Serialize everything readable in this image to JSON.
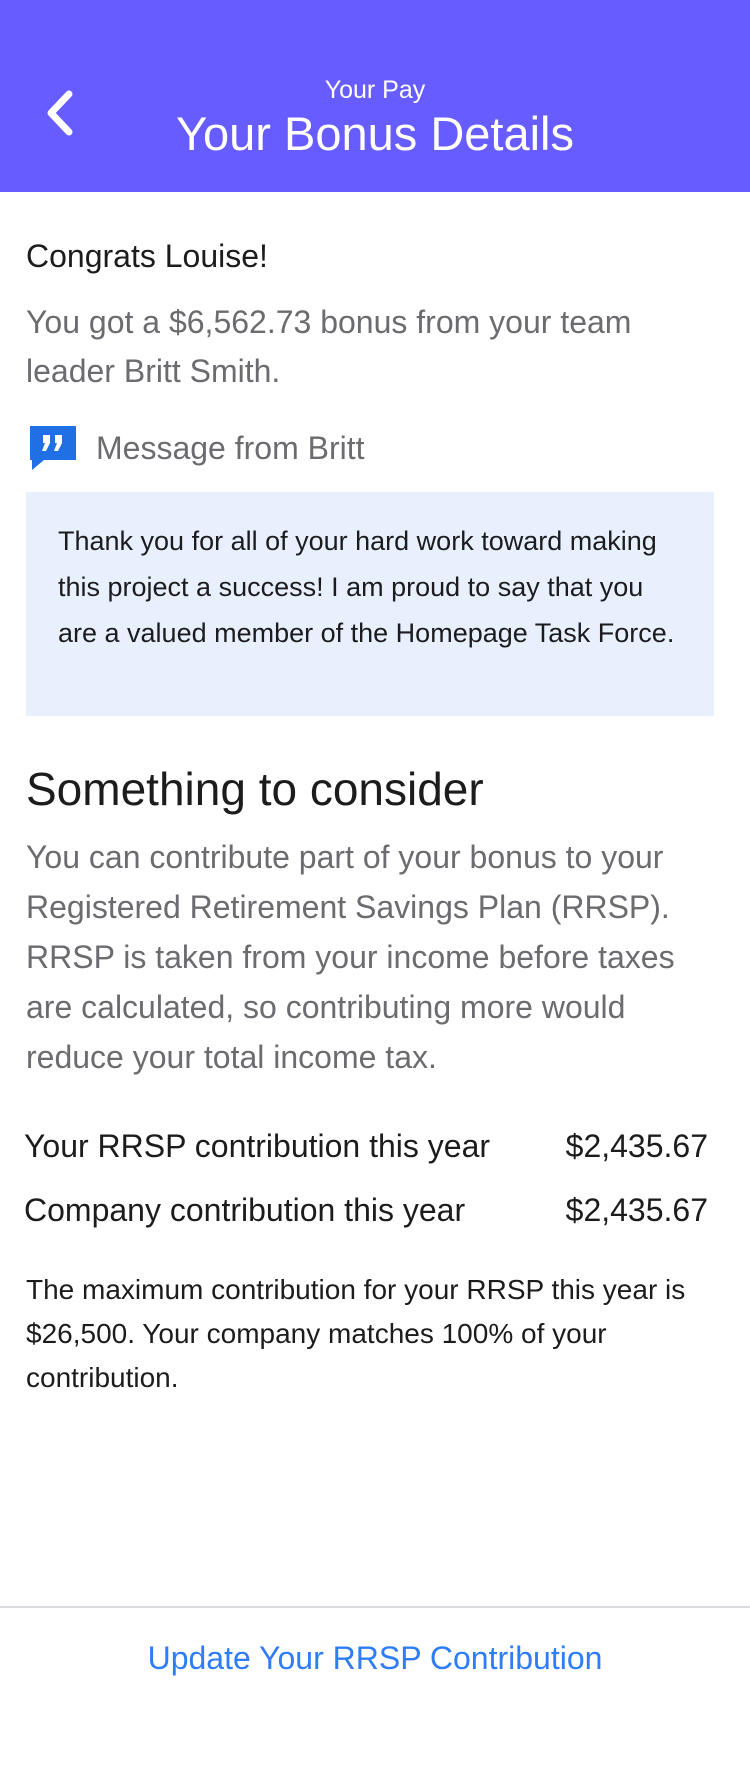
{
  "header": {
    "subtitle": "Your Pay",
    "title": "Your Bonus Details",
    "back_icon": "chevron-left-icon",
    "background_color": "#675cff"
  },
  "greeting": "Congrats Louise!",
  "bonus_message": "You got a $6,562.73 bonus from your team leader Britt Smith.",
  "message": {
    "icon": "quote-icon",
    "label": "Message from Britt",
    "text": "Thank you for all of your hard work toward making this project a success! I am proud to say that you are a valued member of the Homepage Task Force."
  },
  "consider": {
    "title": "Something to consider",
    "text": "You can contribute part of your bonus to your Registered Retirement Savings Plan (RRSP). RRSP is taken from your income before taxes are calculated, so contributing more would reduce your total income tax."
  },
  "contributions": [
    {
      "label": "Your RRSP contribution this year",
      "amount": "$2,435.67"
    },
    {
      "label": "Company contribution this year",
      "amount": "$2,435.67"
    }
  ],
  "max_note": "The maximum contribution for your RRSP this year is $26,500. Your company matches 100% of your contribution.",
  "cta": {
    "label": "Update Your RRSP Contribution",
    "color": "#2f7df6"
  }
}
